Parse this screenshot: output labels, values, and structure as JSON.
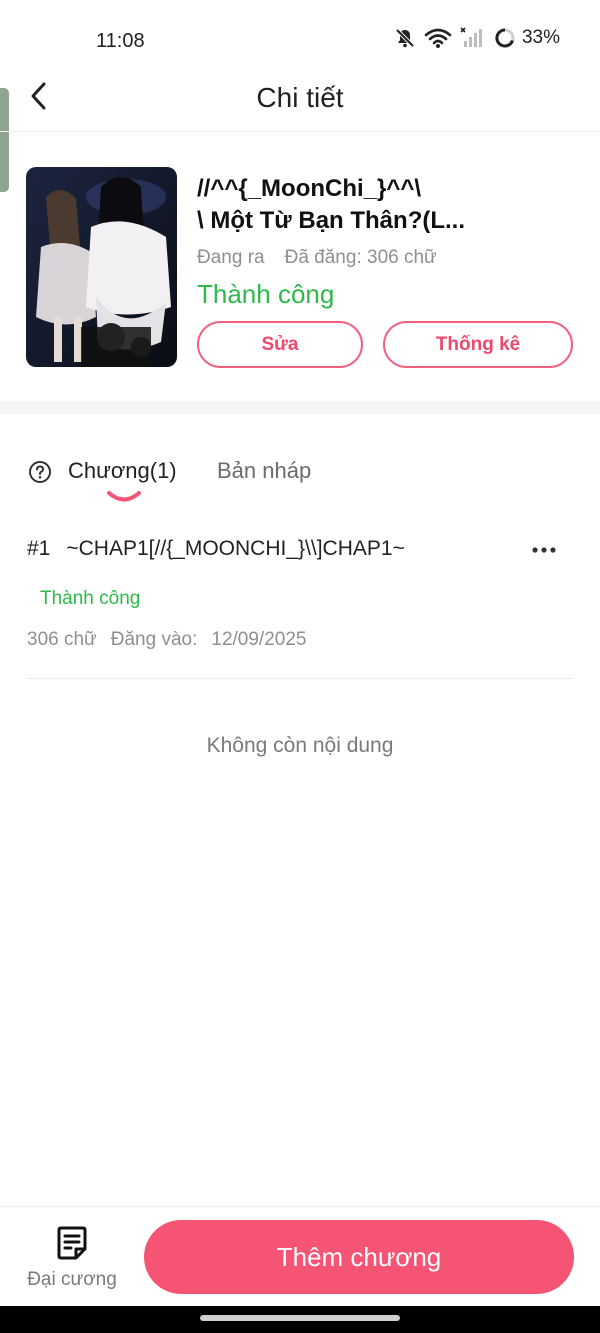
{
  "status_bar": {
    "time": "11:08",
    "battery": "33%"
  },
  "header": {
    "title": "Chi tiết"
  },
  "work": {
    "title_line1": "//^^{_MoonChi_}^^\\",
    "title_line2": "\\ Một Từ Bạn Thân?(L...",
    "state": "Đang ra",
    "words": "Đã đăng: 306 chữ",
    "status": "Thành  công",
    "edit_label": "Sửa",
    "stats_label": "Thống kê"
  },
  "tabs": {
    "chapters": "Chương(1)",
    "drafts": "Bản nháp"
  },
  "chapters": [
    {
      "number": "#1",
      "title": "~CHAP1[//{_MOONCHI_}\\\\]CHAP1~",
      "status": "Thành công",
      "words": "306 chữ",
      "posted_label": "Đăng vào:",
      "date": "12/09/2025"
    }
  ],
  "list_end": "Không còn nội dung",
  "bottom": {
    "outline_label": "Đại cương",
    "add_label": "Thêm chương"
  },
  "colors": {
    "accent": "#f65474",
    "success": "#2fb94b",
    "muted": "#8f8f8f"
  }
}
